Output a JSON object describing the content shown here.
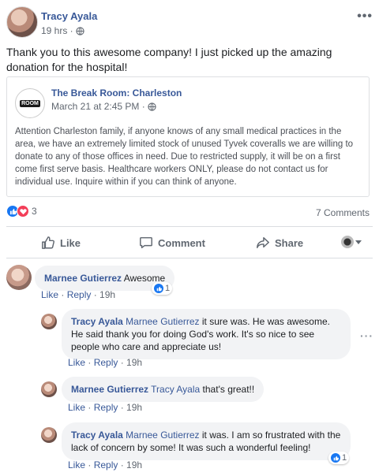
{
  "post": {
    "author": "Tracy Ayala",
    "time": "19 hrs ·",
    "text": "Thank you to this awesome company! I just picked up the amazing donation for the hospital!"
  },
  "shared": {
    "page_name": "The Break Room: Charleston",
    "logo_text": "ROOM",
    "time": "March 21 at 2:45 PM ·",
    "text": "Attention Charleston family, if anyone knows of any small medical practices in the area, we have an extremely limited stock of unused Tyvek coveralls we are willing to donate to any of those offices in need. Due to restricted supply, it will be on a first come first serve basis. Healthcare workers ONLY, please do not contact us for individual use. Inquire within if you can think of anyone."
  },
  "stats": {
    "reactions_count": "3",
    "comments_count": "7 Comments"
  },
  "actions": {
    "like": "Like",
    "comment": "Comment",
    "share": "Share"
  },
  "comments": [
    {
      "name": "Marnee Gutierrez",
      "tag": "",
      "text": "Awesome",
      "like": "Like",
      "reply": "Reply",
      "time": "19h",
      "likes": "1"
    },
    {
      "name": "Tracy Ayala",
      "tag": "Marnee Gutierrez",
      "text": "it sure was. He was awesome. He said thank you for doing God's work. It's so nice to see people who care and appreciate us!",
      "like": "Like",
      "reply": "Reply",
      "time": "19h"
    },
    {
      "name": "Marnee Gutierrez",
      "tag": "Tracy Ayala",
      "text": "that's great!!",
      "like": "Like",
      "reply": "Reply",
      "time": "19h"
    },
    {
      "name": "Tracy Ayala",
      "tag": "Marnee Gutierrez",
      "text": "it was. I am so frustrated with the lack of concern by some! It was such a wonderful feeling!",
      "like": "Like",
      "reply": "Reply",
      "time": "19h",
      "likes": "1"
    }
  ],
  "icons": {
    "globe": "globe-icon",
    "like": "thumbs-up-icon",
    "comment": "comment-icon",
    "share": "share-icon",
    "love": "heart-icon"
  },
  "colors": {
    "link": "#385898",
    "like_blue": "#1877f2",
    "love_red": "#f33e58"
  }
}
